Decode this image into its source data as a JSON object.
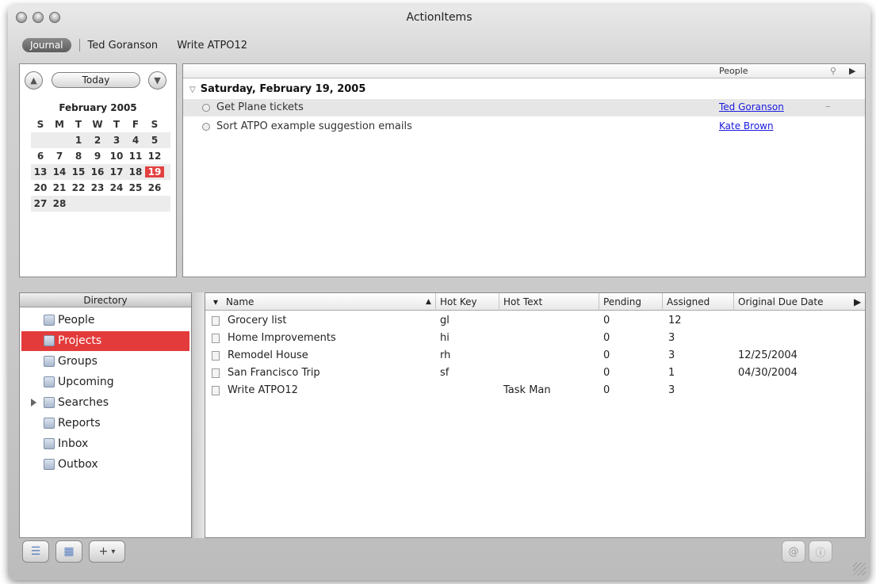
{
  "window": {
    "title": "ActionItems"
  },
  "breadcrumb": {
    "journal": "Journal",
    "person": "Ted Goranson",
    "project": "Write ATPO12"
  },
  "calendar": {
    "today_label": "Today",
    "month_title": "February 2005",
    "weekdays": [
      "S",
      "M",
      "T",
      "W",
      "T",
      "F",
      "S"
    ],
    "weeks": [
      [
        "",
        "",
        "1",
        "2",
        "3",
        "4",
        "5"
      ],
      [
        "6",
        "7",
        "8",
        "9",
        "10",
        "11",
        "12"
      ],
      [
        "13",
        "14",
        "15",
        "16",
        "17",
        "18",
        "19"
      ],
      [
        "20",
        "21",
        "22",
        "23",
        "24",
        "25",
        "26"
      ],
      [
        "27",
        "28",
        "",
        "",
        "",
        "",
        ""
      ]
    ],
    "selected_day": "19"
  },
  "journal": {
    "column_people": "People",
    "date_heading": "Saturday, February 19, 2005",
    "entries": [
      {
        "text": "Get Plane tickets",
        "person": "Ted Goranson"
      },
      {
        "text": "Sort ATPO example suggestion emails",
        "person": "Kate Brown"
      }
    ]
  },
  "directory": {
    "header": "Directory",
    "items": [
      {
        "label": "People",
        "icon": "people-icon"
      },
      {
        "label": "Projects",
        "icon": "projects-icon",
        "selected": true
      },
      {
        "label": "Groups",
        "icon": "groups-icon"
      },
      {
        "label": "Upcoming",
        "icon": "upcoming-icon"
      },
      {
        "label": "Searches",
        "icon": "search-icon"
      },
      {
        "label": "Reports",
        "icon": "reports-icon"
      },
      {
        "label": "Inbox",
        "icon": "inbox-icon"
      },
      {
        "label": "Outbox",
        "icon": "outbox-icon"
      }
    ]
  },
  "projects": {
    "columns": [
      "Name",
      "Hot Key",
      "Hot Text",
      "Pending",
      "Assigned",
      "Original Due Date"
    ],
    "rows": [
      {
        "name": "Grocery list",
        "hotkey": "gl",
        "hottext": "",
        "pending": "0",
        "assigned": "12",
        "due": ""
      },
      {
        "name": "Home Improvements",
        "hotkey": "hi",
        "hottext": "",
        "pending": "0",
        "assigned": "3",
        "due": ""
      },
      {
        "name": "Remodel House",
        "hotkey": "rh",
        "hottext": "",
        "pending": "0",
        "assigned": "3",
        "due": "12/25/2004"
      },
      {
        "name": "San Francisco Trip",
        "hotkey": "sf",
        "hottext": "",
        "pending": "0",
        "assigned": "1",
        "due": "04/30/2004"
      },
      {
        "name": "Write ATPO12",
        "hotkey": "",
        "hottext": "Task Man",
        "pending": "0",
        "assigned": "3",
        "due": ""
      }
    ]
  },
  "toolbar": {
    "add_label": "+"
  },
  "colors": {
    "selection": "#e33b3b",
    "link": "#1a1adf"
  }
}
